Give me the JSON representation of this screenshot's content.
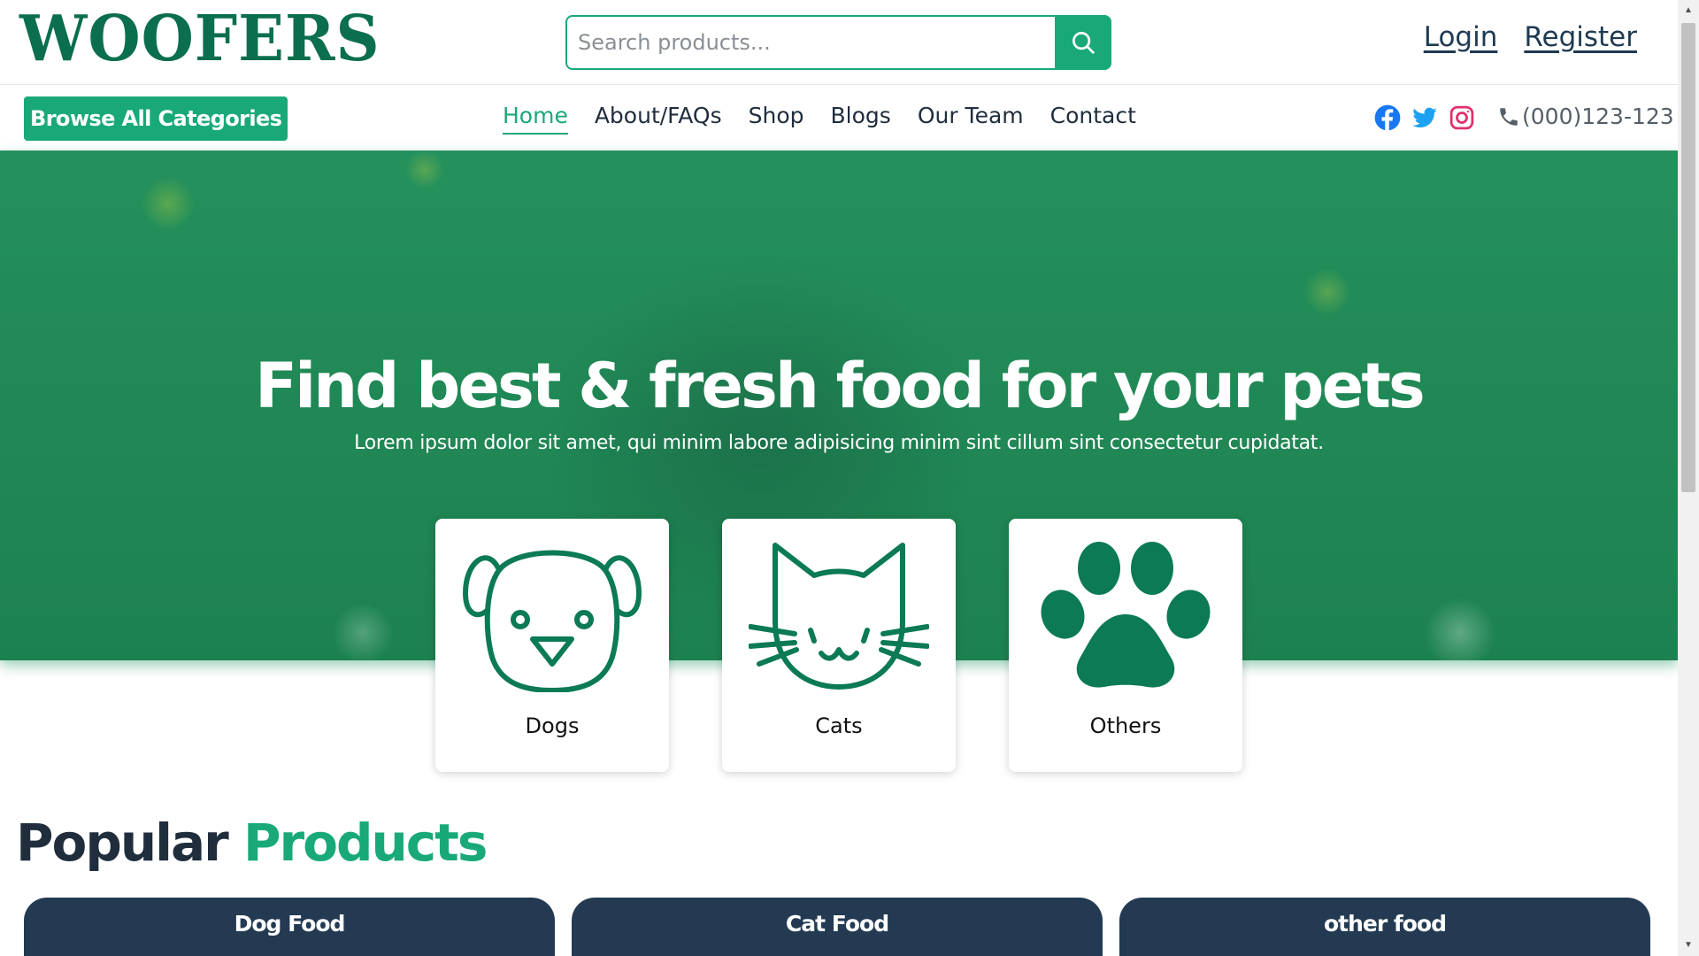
{
  "header": {
    "logo_text": "WOOFERS",
    "search_placeholder": "Search products...",
    "search_icon": "search-icon",
    "login_label": "Login",
    "register_label": "Register"
  },
  "nav": {
    "browse_label": "Browse All Categories",
    "links": [
      {
        "label": "Home",
        "active": true
      },
      {
        "label": "About/FAQs"
      },
      {
        "label": "Shop"
      },
      {
        "label": "Blogs"
      },
      {
        "label": "Our Team"
      },
      {
        "label": "Contact"
      }
    ],
    "socials": [
      "facebook-icon",
      "twitter-icon",
      "instagram-icon"
    ],
    "phone": "(000)123-123"
  },
  "hero": {
    "title": "Find best & fresh food for your pets",
    "subtitle": "Lorem ipsum dolor sit amet, qui minim labore adipisicing minim sint cillum sint consectetur cupidatat."
  },
  "categories": [
    {
      "label": "Dogs",
      "icon": "dog-icon"
    },
    {
      "label": "Cats",
      "icon": "cat-icon"
    },
    {
      "label": "Others",
      "icon": "paw-icon"
    }
  ],
  "popular": {
    "title_part1": "Popular",
    "title_part2": "Products",
    "tabs": [
      "Dog Food",
      "Cat Food",
      "other food"
    ]
  },
  "colors": {
    "brand_green": "#19a978",
    "logo_green": "#0b6e4f",
    "navy": "#233a52",
    "facebook": "#1877f2",
    "twitter": "#1da1f2",
    "instagram": "#e1306c"
  }
}
